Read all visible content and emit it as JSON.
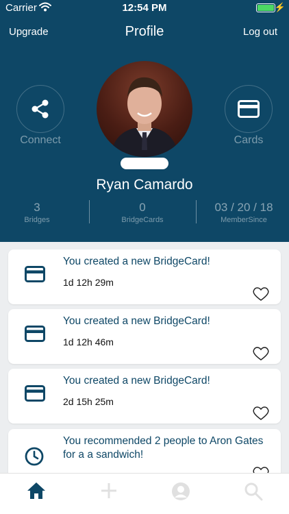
{
  "status_bar": {
    "carrier": "Carrier",
    "time": "12:54 PM"
  },
  "nav": {
    "upgrade": "Upgrade",
    "title": "Profile",
    "logout": "Log out"
  },
  "profile": {
    "connect_label": "Connect",
    "cards_label": "Cards",
    "name": "Ryan Camardo"
  },
  "stats": [
    {
      "value": "3",
      "label": "Bridges"
    },
    {
      "value": "0",
      "label": "BridgeCards"
    },
    {
      "value": "03 / 20 / 18",
      "label": "MemberSince"
    }
  ],
  "feed": [
    {
      "icon": "card-icon",
      "title": "You created a new BridgeCard!",
      "time": "1d 12h 29m"
    },
    {
      "icon": "card-icon",
      "title": "You created a new BridgeCard!",
      "time": "1d 12h 46m"
    },
    {
      "icon": "card-icon",
      "title": "You created a new BridgeCard!",
      "time": "2d 15h 25m"
    },
    {
      "icon": "clock-icon",
      "title": "You recommended 2 people to Aron Gates for a a sandwich!",
      "time": ""
    }
  ],
  "tabs": [
    {
      "icon": "home-icon",
      "active": true
    },
    {
      "icon": "plus-icon",
      "active": false
    },
    {
      "icon": "profile-icon",
      "active": false
    },
    {
      "icon": "search-icon",
      "active": false
    }
  ],
  "colors": {
    "primary": "#0e4766",
    "background": "#eceef0",
    "battery": "#4cd964"
  }
}
